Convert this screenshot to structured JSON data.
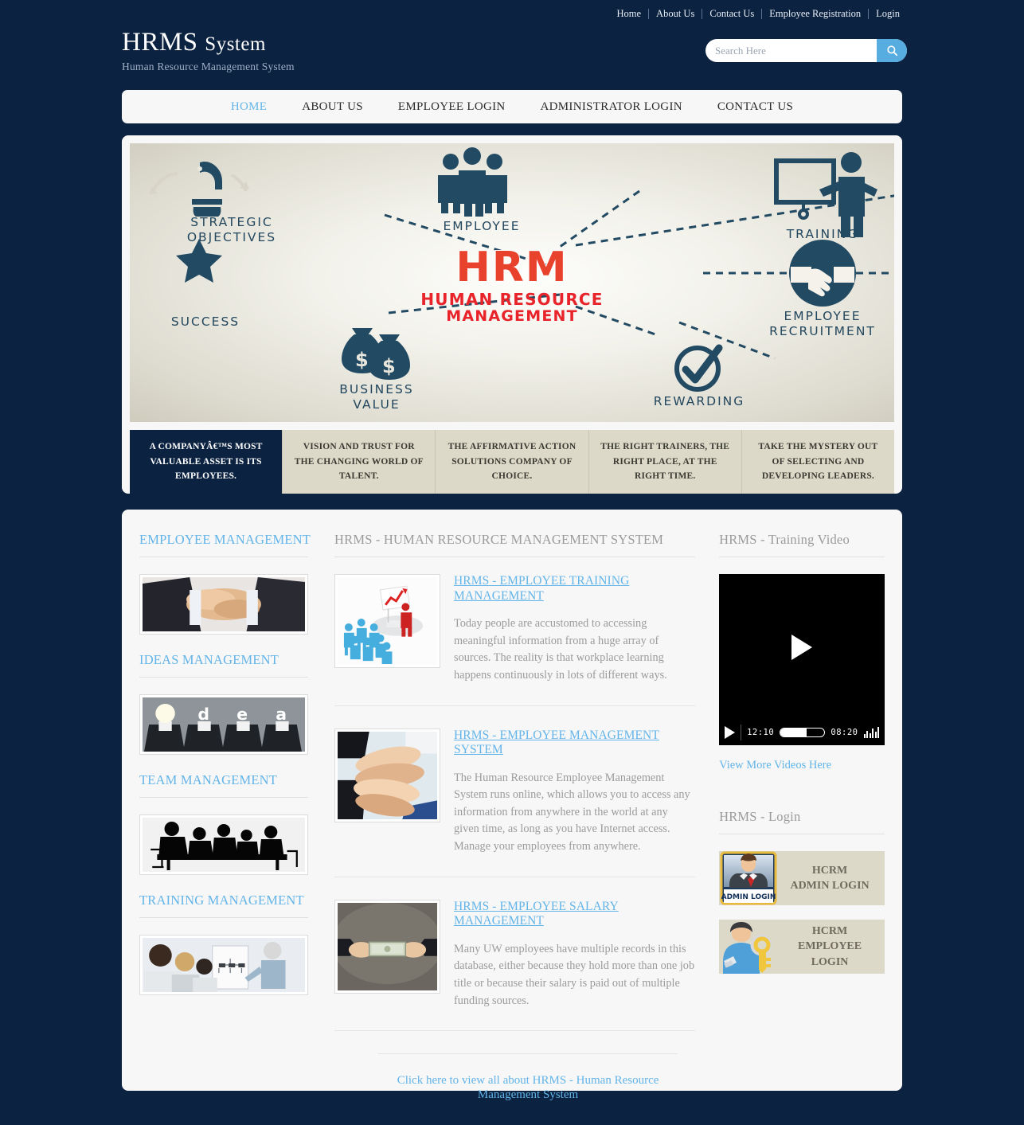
{
  "site": {
    "title_main": "HRMS",
    "title_small": "System",
    "tagline": "Human Resource Management System",
    "accent_blue": "#63b4e8",
    "bg_navy": "#0b2240",
    "caption_beige": "#ddd9c8"
  },
  "topnav": {
    "items": [
      {
        "label": "Home"
      },
      {
        "label": "About Us"
      },
      {
        "label": "Contact Us"
      },
      {
        "label": "Employee Registration"
      },
      {
        "label": "Login"
      }
    ]
  },
  "search": {
    "placeholder": "Search Here",
    "value": "",
    "icon": "search-icon"
  },
  "mainnav": {
    "items": [
      {
        "label": "HOME",
        "active": true
      },
      {
        "label": "ABOUT US",
        "active": false
      },
      {
        "label": "EMPLOYEE LOGIN",
        "active": false
      },
      {
        "label": "ADMINISTRATOR LOGIN",
        "active": false
      },
      {
        "label": "CONTACT US",
        "active": false
      }
    ]
  },
  "banner": {
    "center_title": "HRM",
    "center_sub_line1": "HUMAN RESOURCE",
    "center_sub_line2": "MANAGEMENT",
    "nodes": [
      {
        "label_line1": "STRATEGIC",
        "label_line2": "OBJECTIVES",
        "icon": "chess-knight-icon"
      },
      {
        "label_line1": "EMPLOYEE",
        "label_line2": "",
        "icon": "people-group-icon"
      },
      {
        "label_line1": "TRAINING",
        "label_line2": "",
        "icon": "presenter-whiteboard-icon"
      },
      {
        "label_line1": "EMPLOYEE",
        "label_line2": "RECRUITMENT",
        "icon": "handshake-icon"
      },
      {
        "label_line1": "REWARDING",
        "label_line2": "",
        "icon": "check-circle-icon"
      },
      {
        "label_line1": "BUSINESS",
        "label_line2": "VALUE",
        "icon": "money-bags-icon"
      },
      {
        "label_line1": "SUCCESS",
        "label_line2": "",
        "icon": "star-icon"
      }
    ],
    "captions": [
      {
        "text": "A COMPANYÂ€™S MOST VALUABLE ASSET IS ITS EMPLOYEES.",
        "active": true
      },
      {
        "text": "VISION AND TRUST FOR THE CHANGING WORLD OF TALENT.",
        "active": false
      },
      {
        "text": "THE AFFIRMATIVE ACTION SOLUTIONS COMPANY OF CHOICE.",
        "active": false
      },
      {
        "text": "THE RIGHT TRAINERS, THE RIGHT PLACE, AT THE RIGHT TIME.",
        "active": false
      },
      {
        "text": "TAKE THE MYSTERY OUT OF SELECTING AND DEVELOPING LEADERS.",
        "active": false
      }
    ]
  },
  "left_column": {
    "sections": [
      {
        "heading": "EMPLOYEE MANAGEMENT",
        "image_name": "handshake-team-photo"
      },
      {
        "heading": "IDEAS MANAGEMENT",
        "image_name": "idea-suits-photo"
      },
      {
        "heading": "TEAM MANAGEMENT",
        "image_name": "team-silhouette-photo"
      },
      {
        "heading": "TRAINING MANAGEMENT",
        "image_name": "training-session-photo"
      }
    ]
  },
  "center_column": {
    "heading": "HRMS - HUMAN RESOURCE MANAGEMENT SYSTEM",
    "articles": [
      {
        "title": "HRMS - EMPLOYEE TRAINING MANAGEMENT",
        "text": "Today people are accustomed to accessing meaningful information from a huge array of sources. The reality is that workplace learning happens continuously in lots of different ways.",
        "image_name": "training-chart-figures-image"
      },
      {
        "title": "HRMS - EMPLOYEE MANAGEMENT SYSTEM",
        "text": "The Human Resource Employee Management System runs online, which allows you to access any information from anywhere in the world at any given time, as long as you have Internet access. Manage your employees from anywhere.",
        "image_name": "stacked-hands-image"
      },
      {
        "title": "HRMS - EMPLOYEE SALARY MANAGEMENT",
        "text": "Many UW employees have multiple records in this database, either because they hold more than one job title or because their salary is paid out of multiple funding sources.",
        "image_name": "cash-handover-image"
      }
    ],
    "bottom_link": "Click here to view all about HRMS - Human Resource Management System"
  },
  "right_column": {
    "video_heading": "HRMS - Training Video",
    "video": {
      "elapsed": "12:10",
      "remaining": "08:20",
      "progress_percent": 60,
      "play_icon": "play-icon",
      "volume_icon": "volume-icon"
    },
    "view_more_link": "View More Videos Here",
    "login_heading": "HRMS - Login",
    "logins": [
      {
        "line1": "HCRM",
        "line2": "ADMIN LOGIN",
        "badge": "ADMIN LOGIN",
        "avatar": "admin-avatar-icon"
      },
      {
        "line1": "HCRM",
        "line2": "EMPLOYEE LOGIN",
        "badge": "",
        "avatar": "employee-key-avatar-icon"
      }
    ]
  }
}
